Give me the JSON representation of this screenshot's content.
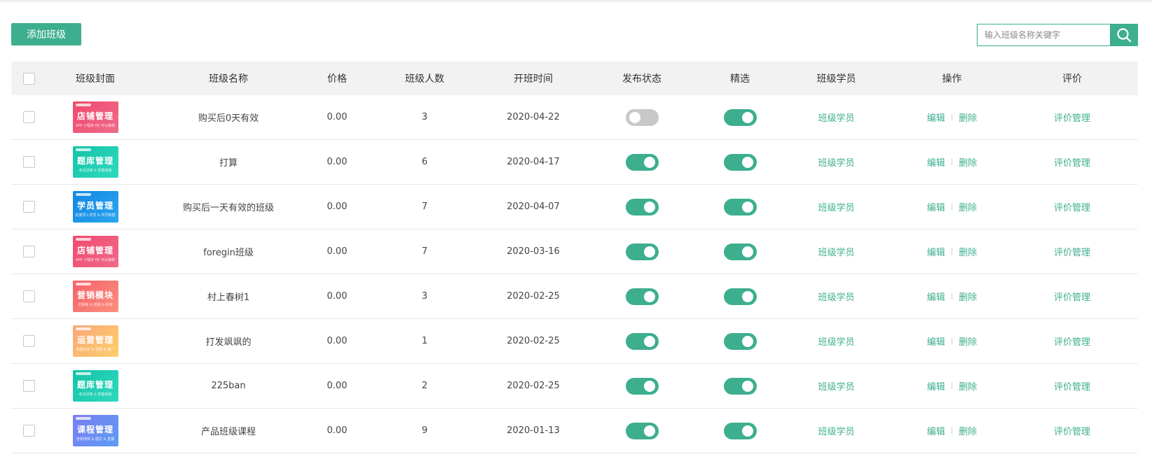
{
  "toolbar": {
    "add_label": "添加班级"
  },
  "search": {
    "placeholder": "输入班级名称关键字",
    "icon": "search-icon"
  },
  "columns": [
    "班级封面",
    "班级名称",
    "价格",
    "班级人数",
    "开班时间",
    "发布状态",
    "精选",
    "班级学员",
    "操作",
    "评价"
  ],
  "actions": {
    "students": "班级学员",
    "edit": "编辑",
    "delete": "删除",
    "rate": "评价管理"
  },
  "colors": {
    "accent": "#3daf8e",
    "toggle_off": "#c8c8c8"
  },
  "covers": [
    {
      "title": "店铺管理",
      "sub": "APP 小程序 H5 可以装修",
      "from": "#f2486e",
      "to": "#ee6b8a"
    },
    {
      "title": "题库管理",
      "sub": "考试试卷 & 智能组卷",
      "from": "#14c3a7",
      "to": "#2fd9c0"
    },
    {
      "title": "学员管理",
      "sub": "批量导入学员 & 学员数据",
      "from": "#1287e2",
      "to": "#2aa5ee"
    },
    {
      "title": "店铺管理",
      "sub": "APP 小程序 H5 可以装修",
      "from": "#f2486e",
      "to": "#ee6b8a"
    },
    {
      "title": "营销模块",
      "sub": "优惠卷 & 拼团 & 秒杀",
      "from": "#f5616a",
      "to": "#fb8f7e"
    },
    {
      "title": "运营管理",
      "sub": "数据分析 & 营销 & 推广",
      "from": "#fba67a",
      "to": "#fdd06b"
    },
    {
      "title": "题库管理",
      "sub": "考试试卷 & 智能组卷",
      "from": "#14c3a7",
      "to": "#2fd9c0"
    },
    {
      "title": "课程管理",
      "sub": "音频视频 & 图文 & 直播",
      "from": "#7a7ef0",
      "to": "#5d9bf5"
    }
  ],
  "rows": [
    {
      "name": "购买后0天有效",
      "price": "0.00",
      "count": "3",
      "date": "2020-04-22",
      "published": false,
      "featured": true
    },
    {
      "name": "打算",
      "price": "0.00",
      "count": "6",
      "date": "2020-04-17",
      "published": true,
      "featured": true
    },
    {
      "name": "购买后一天有效的班级",
      "price": "0.00",
      "count": "7",
      "date": "2020-04-07",
      "published": true,
      "featured": true
    },
    {
      "name": "foregin班级",
      "price": "0.00",
      "count": "7",
      "date": "2020-03-16",
      "published": true,
      "featured": true
    },
    {
      "name": "村上春树1",
      "price": "0.00",
      "count": "3",
      "date": "2020-02-25",
      "published": true,
      "featured": true
    },
    {
      "name": "打发飒飒的",
      "price": "0.00",
      "count": "1",
      "date": "2020-02-25",
      "published": true,
      "featured": true
    },
    {
      "name": "225ban",
      "price": "0.00",
      "count": "2",
      "date": "2020-02-25",
      "published": true,
      "featured": true
    },
    {
      "name": "产品班级课程",
      "price": "0.00",
      "count": "9",
      "date": "2020-01-13",
      "published": true,
      "featured": true
    }
  ]
}
